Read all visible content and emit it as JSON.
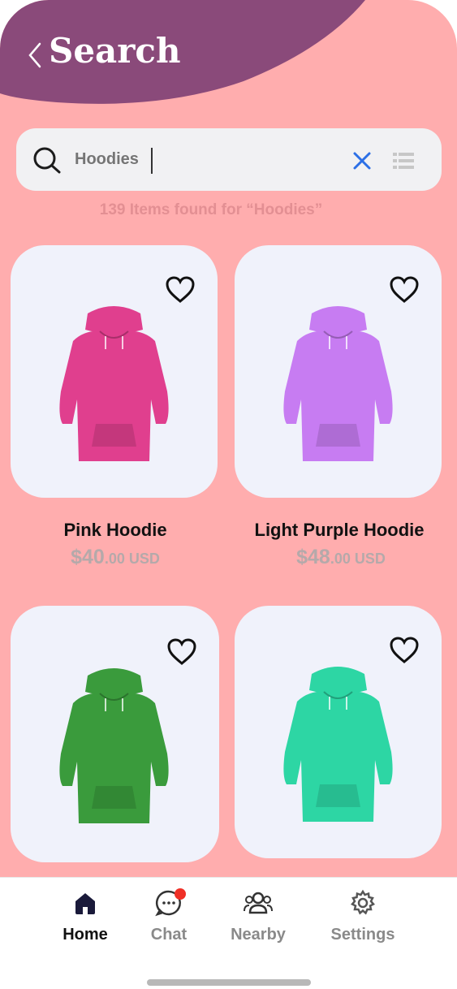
{
  "header": {
    "title": "Search"
  },
  "search": {
    "query": "Hoodies",
    "placeholder": ""
  },
  "results": {
    "summary": "139 Items found for “Hoodies”"
  },
  "products": [
    {
      "name": "Pink Hoodie",
      "price_main": "$40",
      "price_cents": ".00 USD",
      "color": "#e03f8e",
      "favorite": false
    },
    {
      "name": "Light Purple Hoodie",
      "price_main": "$48",
      "price_cents": ".00 USD",
      "color": "#c77cf2",
      "favorite": false
    },
    {
      "name": "",
      "price_main": "",
      "price_cents": "",
      "color": "#3a9b3c",
      "favorite": false
    },
    {
      "name": "",
      "price_main": "",
      "price_cents": "",
      "color": "#2dd6a4",
      "favorite": false
    }
  ],
  "tabbar": {
    "items": [
      {
        "label": "Home",
        "icon": "home-icon",
        "active": true
      },
      {
        "label": "Chat",
        "icon": "chat-icon",
        "active": false,
        "badge": true
      },
      {
        "label": "Nearby",
        "icon": "people-icon",
        "active": false
      },
      {
        "label": "Settings",
        "icon": "gear-icon",
        "active": false
      }
    ]
  },
  "colors": {
    "background": "#ffadae",
    "header": "#8a4a7a",
    "card": "#f0f2fb",
    "accent_clear": "#2c6fe6",
    "badge": "#ef2f26"
  }
}
